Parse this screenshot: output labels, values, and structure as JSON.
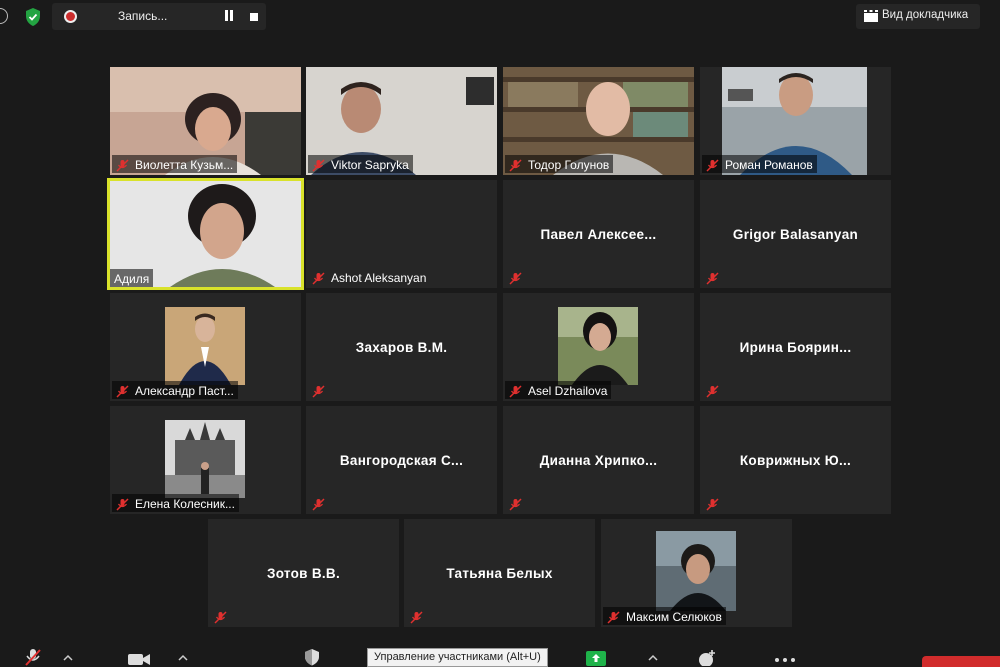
{
  "topbar": {
    "recording_label": "Запись...",
    "view_label": "Вид докладчика"
  },
  "tiles": [
    {
      "id": "t1",
      "label": "Виолетта Кузьм...",
      "display_name": "",
      "video": true,
      "muted": true
    },
    {
      "id": "t2",
      "label": "Viktor Saprуka",
      "display_name": "",
      "video": true,
      "muted": true
    },
    {
      "id": "t3",
      "label": "Тодор Голунов",
      "display_name": "",
      "video": true,
      "muted": true
    },
    {
      "id": "t4",
      "label": "Роман Романов",
      "display_name": "",
      "video": true,
      "muted": true
    },
    {
      "id": "t5",
      "label": "Адиля",
      "display_name": "",
      "video": true,
      "muted": false,
      "active": true
    },
    {
      "id": "t6",
      "label": "Ashot Aleksanyan",
      "display_name": "",
      "video": false,
      "muted": true
    },
    {
      "id": "t7",
      "label": "",
      "display_name": "Павел  Алексее...",
      "video": false,
      "muted": true
    },
    {
      "id": "t8",
      "label": "",
      "display_name": "Grigor Balasanyan",
      "video": false,
      "muted": true
    },
    {
      "id": "t9",
      "label": "Александр Паст...",
      "display_name": "",
      "video": true,
      "muted": true
    },
    {
      "id": "t10",
      "label": "",
      "display_name": "Захаров В.М.",
      "video": false,
      "muted": true
    },
    {
      "id": "t11",
      "label": "Asel Dzhailova",
      "display_name": "",
      "video": true,
      "muted": true
    },
    {
      "id": "t12",
      "label": "",
      "display_name": "Ирина  Боярин...",
      "video": false,
      "muted": true
    },
    {
      "id": "t13",
      "label": "Елена Колесник...",
      "display_name": "",
      "video": true,
      "muted": true
    },
    {
      "id": "t14",
      "label": "",
      "display_name": "Вангородская  С...",
      "video": false,
      "muted": true
    },
    {
      "id": "t15",
      "label": "",
      "display_name": "Дианна  Хрипко...",
      "video": false,
      "muted": true
    },
    {
      "id": "t16",
      "label": "",
      "display_name": "Коврижных  Ю...",
      "video": false,
      "muted": true
    },
    {
      "id": "t17",
      "label": "",
      "display_name": "Зотов В.В.",
      "video": false,
      "muted": true
    },
    {
      "id": "t18",
      "label": "",
      "display_name": "Татьяна Белых",
      "video": false,
      "muted": true
    },
    {
      "id": "t19",
      "label": "Максим Селюков",
      "display_name": "",
      "video": true,
      "muted": true
    }
  ],
  "bottombar": {
    "tooltip": "Управление участниками (Alt+U)"
  },
  "colors": {
    "active_speaker": "#d9e22b",
    "mute": "#e0302f",
    "share": "#1fb34a",
    "end": "#d12c2c"
  }
}
